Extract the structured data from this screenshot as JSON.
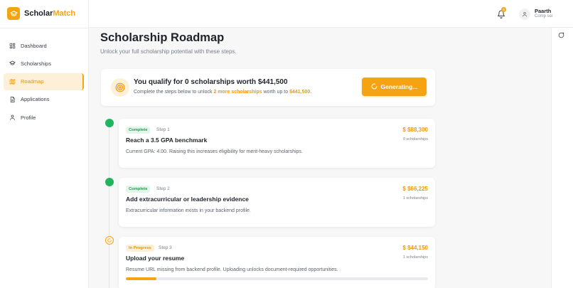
{
  "brand": {
    "name_main": "Scholar",
    "name_accent": "Match",
    "color": "#f6a313"
  },
  "sidebar": {
    "items": [
      {
        "label": "Dashboard",
        "icon": "dashboard-icon",
        "active": false
      },
      {
        "label": "Scholarships",
        "icon": "graduation-cap-icon",
        "active": false
      },
      {
        "label": "Roadmap",
        "icon": "map-icon",
        "active": true
      },
      {
        "label": "Applications",
        "icon": "document-icon",
        "active": false
      },
      {
        "label": "Profile",
        "icon": "user-icon",
        "active": false
      }
    ]
  },
  "topbar": {
    "notification_count": "0",
    "user": {
      "name": "Paarth",
      "subtitle": "Comp sci"
    }
  },
  "page": {
    "title": "Scholarship Roadmap",
    "subtitle": "Unlock your full scholarship potential with these steps."
  },
  "qualify": {
    "title": "You qualify for 0 scholarships worth $441,500",
    "sub_prefix": "Complete the steps below to unlock ",
    "sub_highlight1": "2 more scholarships",
    "sub_middle": " worth up to ",
    "sub_highlight2": "$441,500",
    "sub_suffix": ".",
    "button_label": "Generating..."
  },
  "steps": [
    {
      "status": "Complete",
      "step_label": "Step 1",
      "title": "Reach a 3.5 GPA benchmark",
      "description": "Current GPA: 4.00. Raising this increases eligibility for merit-heavy scholarships.",
      "amount": "$ $88,300",
      "count": "0 scholarships"
    },
    {
      "status": "Complete",
      "step_label": "Step 2",
      "title": "Add extracurricular or leadership evidence",
      "description": "Extracurricular information exists in your backend profile.",
      "amount": "$ $66,225",
      "count": "1 scholarships"
    },
    {
      "status": "In Progress",
      "step_label": "Step 3",
      "title": "Upload your resume",
      "description": "Resume URL missing from backend profile. Uploading unlocks document-required opportunities.",
      "amount": "$ $44,150",
      "count": "1 scholarships",
      "progress_fraction": 0.1
    }
  ],
  "colors": {
    "accent": "#f6a313",
    "complete_green": "#22b35e",
    "active_bg": "#fdf0d8"
  }
}
